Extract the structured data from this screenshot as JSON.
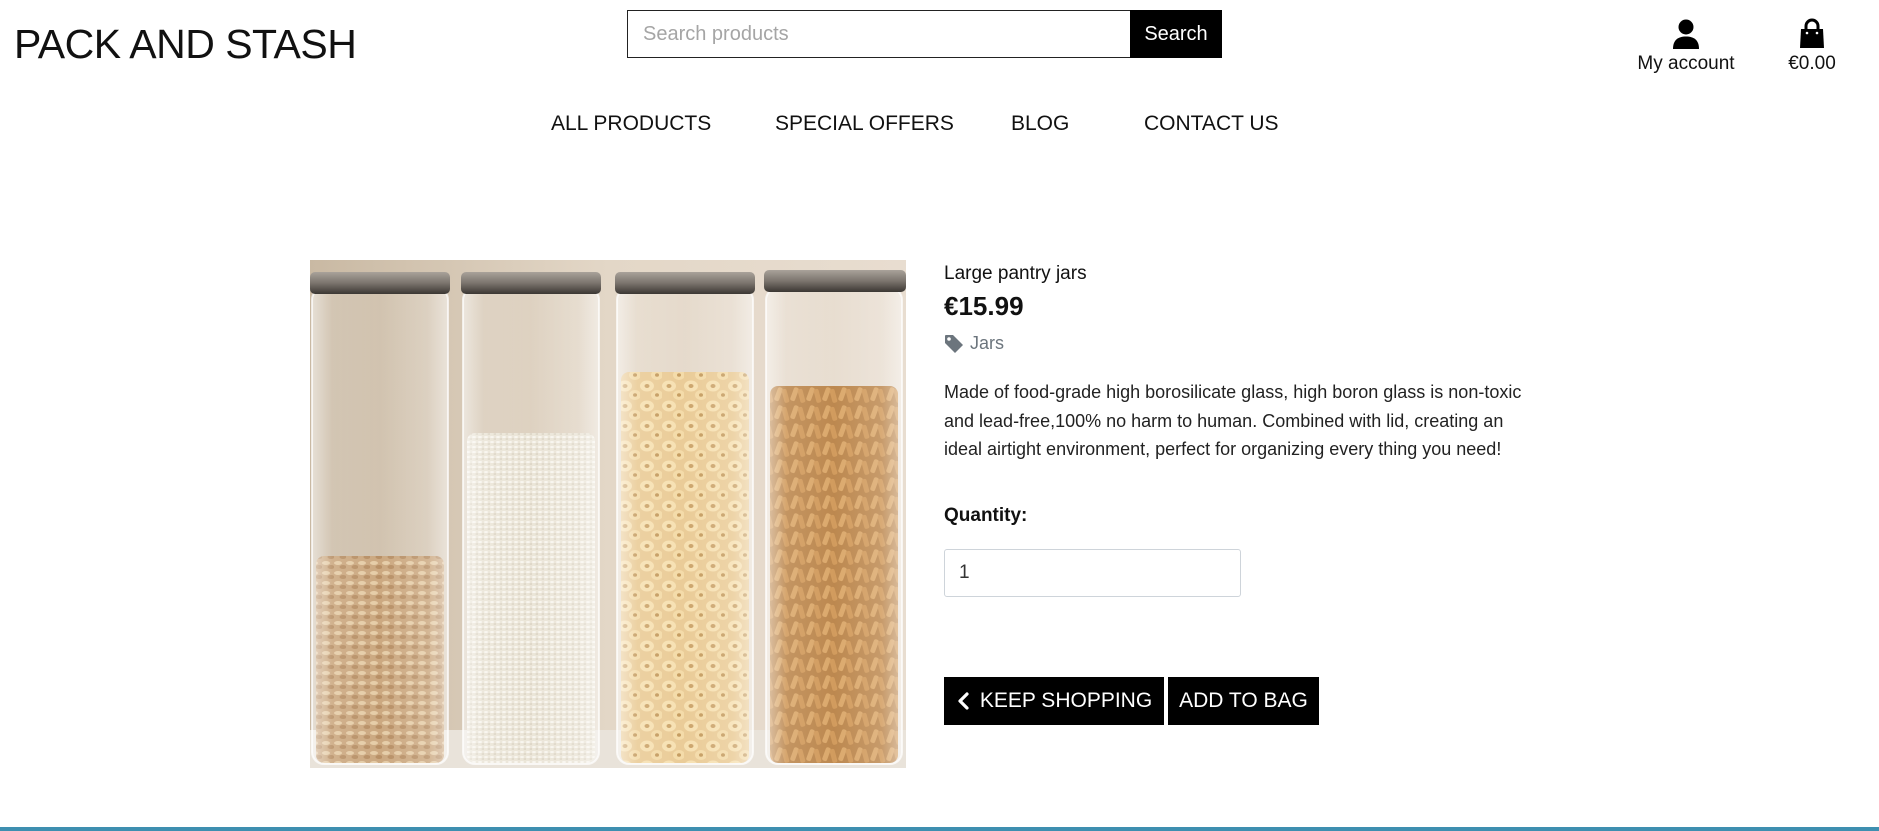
{
  "brand": {
    "logo_text": "PACK AND STASH"
  },
  "search": {
    "placeholder": "Search products",
    "button_label": "Search"
  },
  "header": {
    "account_label": "My account",
    "bag_total": "€0.00"
  },
  "nav": {
    "items": [
      {
        "label": "ALL PRODUCTS"
      },
      {
        "label": "SPECIAL OFFERS"
      },
      {
        "label": "BLOG"
      },
      {
        "label": "CONTACT US"
      }
    ]
  },
  "product": {
    "name": "Large pantry jars",
    "price": "€15.99",
    "category": "Jars",
    "description": "Made of food-grade high borosilicate glass, high boron glass is non-toxic and lead-free,100% no harm to human. Combined with lid, creating an ideal airtight environment, perfect for organizing every thing you need!",
    "quantity_label": "Quantity:",
    "quantity_value": "1",
    "keep_shopping_label": "KEEP SHOPPING",
    "add_to_bag_label": "ADD TO BAG"
  },
  "icons": {
    "account": "user-icon",
    "bag": "shopping-bag-icon",
    "category": "tag-icon",
    "back": "chevron-left-icon"
  },
  "colors": {
    "primary_button": "#000000",
    "footer_accent": "#3e8fb0",
    "muted_text": "#6c757d"
  }
}
